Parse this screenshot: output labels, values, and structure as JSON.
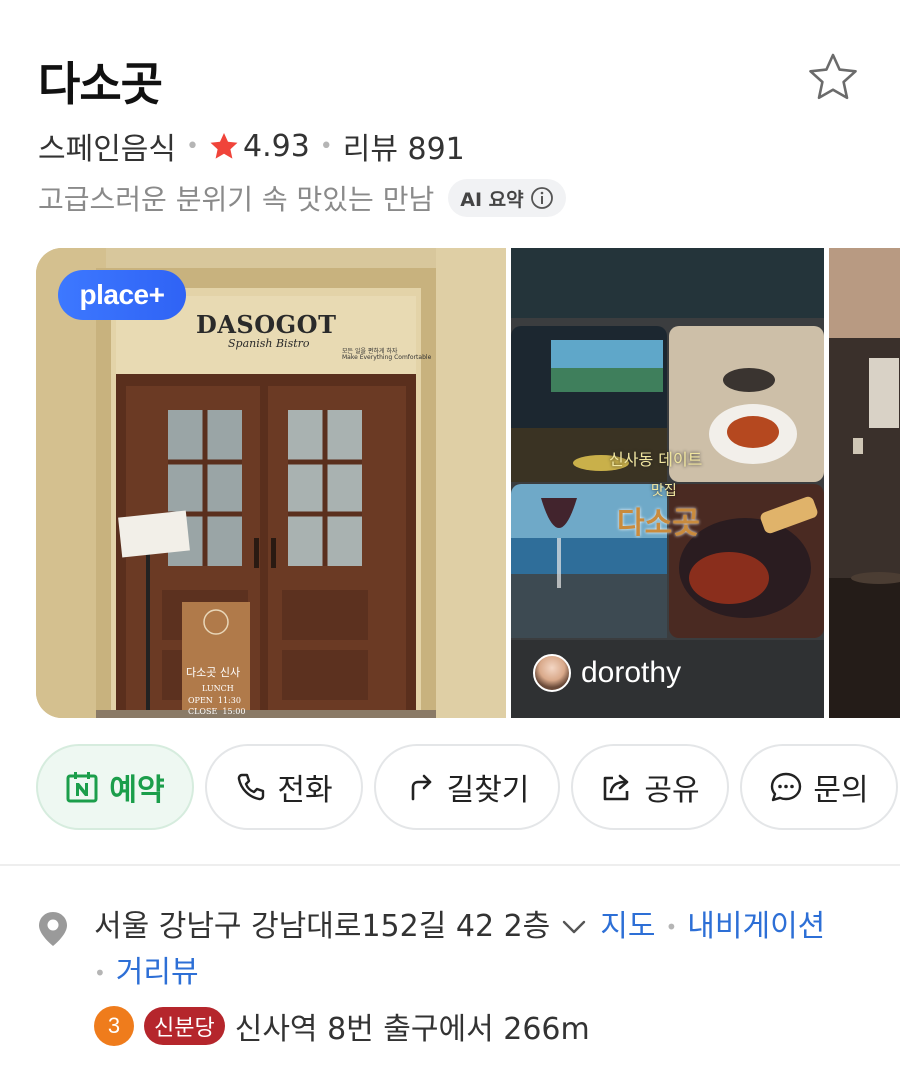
{
  "place": {
    "name": "다소곳",
    "category": "스페인음식",
    "rating": "4.93",
    "review_label": "리뷰 891",
    "summary": "고급스러운 분위기 속 맛있는 만남",
    "ai_badge": "AI 요약",
    "bookmark_icon": "star-outline-icon"
  },
  "gallery": {
    "badge": "place+",
    "photos": [
      {
        "sign_title": "DASOGOT",
        "sign_subtitle": "Spanish Bistro",
        "sign_small_1": "모든 일을 편하게 하자",
        "sign_small_2": "Make Everything Comfortable",
        "board_title": "다소곳 신사",
        "board_line1": "LUNCH",
        "board_line2": "OPEN  11:30",
        "board_line3": "CLOSE  15:00"
      },
      {
        "caption_1": "신사동 데이트",
        "caption_2": "맛집",
        "caption_3": "다소곳",
        "author": "dorothy"
      }
    ]
  },
  "actions": [
    {
      "label": "예약",
      "icon": "naver-booking-icon"
    },
    {
      "label": "전화",
      "icon": "phone-icon"
    },
    {
      "label": "길찾기",
      "icon": "directions-arrow-icon"
    },
    {
      "label": "공유",
      "icon": "share-icon"
    },
    {
      "label": "문의",
      "icon": "chat-bubble-icon"
    }
  ],
  "address": {
    "text": "서울 강남구 강남대로152길 42 2층",
    "link_map": "지도",
    "link_nav": "내비게이션",
    "link_street": "거리뷰"
  },
  "transit": {
    "line_number": "3",
    "line_name": "신분당",
    "direction": "신사역 8번 출구에서 266m"
  },
  "colors": {
    "rating_star": "#f0443a",
    "link": "#2d6fd6",
    "reserve_green": "#1b9e4b",
    "line3_orange": "#ef7c1c",
    "shinbundang_red": "#b5262c",
    "placeplus_blue": "#3d78ff"
  }
}
